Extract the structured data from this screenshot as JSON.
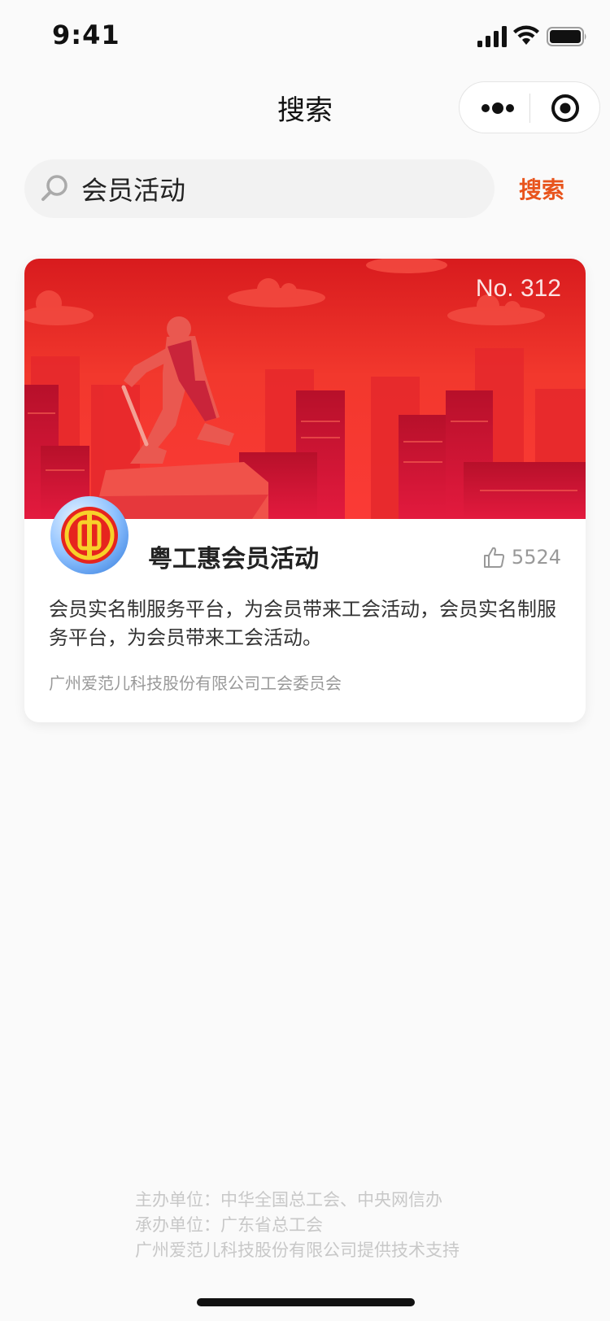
{
  "status_bar": {
    "time": "9:41"
  },
  "nav": {
    "title": "搜索"
  },
  "search": {
    "value": "会员活动",
    "button_label": "搜索"
  },
  "card": {
    "number": "No. 312",
    "title": "粤工惠会员活动",
    "likes": "5524",
    "description": "会员实名制服务平台，为会员带来工会活动，会员实名制服务平台，为会员带来工会活动。",
    "organization": "广州爱范儿科技股份有限公司工会委员会"
  },
  "footer": {
    "line1": "主办单位：中华全国总工会、中央网信办",
    "line2": "承办单位：广东省总工会",
    "line3": "广州爱范儿科技股份有限公司提供技术支持"
  },
  "colors": {
    "accent": "#e8541c",
    "banner_red": "#f23a2e"
  },
  "icons": [
    "signal-icon",
    "wifi-icon",
    "battery-icon",
    "more-icon",
    "target-icon",
    "search-icon",
    "thumbs-up-icon",
    "union-logo"
  ]
}
